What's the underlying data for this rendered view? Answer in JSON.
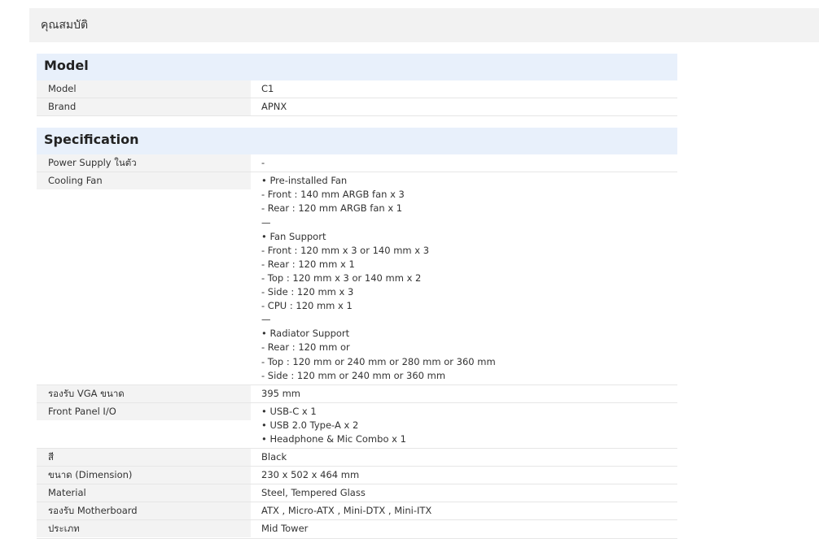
{
  "page": {
    "title": "คุณสมบัติ"
  },
  "sections": [
    {
      "header": "Model",
      "rows": [
        {
          "label": "Model",
          "value": [
            "C1"
          ]
        },
        {
          "label": "Brand",
          "value": [
            "APNX"
          ]
        }
      ]
    },
    {
      "header": "Specification",
      "rows": [
        {
          "label": "Power Supply ในตัว",
          "value": [
            "-"
          ]
        },
        {
          "label": "Cooling Fan",
          "value": [
            "• Pre-installed Fan",
            "- Front : 140 mm ARGB fan x 3",
            "- Rear : 120 mm ARGB fan x 1",
            "—",
            "• Fan Support",
            "- Front : 120 mm x 3 or 140 mm x 3",
            "- Rear : 120 mm x 1",
            "- Top : 120 mm x 3 or 140 mm x 2",
            "- Side : 120 mm x 3",
            "- CPU : 120 mm x 1",
            "—",
            "• Radiator Support",
            "- Rear : 120 mm or",
            "- Top : 120 mm or 240 mm or 280 mm or 360 mm",
            "- Side : 120 mm or 240 mm or 360 mm"
          ]
        },
        {
          "label": "รองรับ VGA ขนาด",
          "value": [
            "395 mm"
          ]
        },
        {
          "label": "Front Panel I/O",
          "value": [
            "• USB-C x 1",
            "• USB 2.0 Type-A x 2",
            "• Headphone & Mic Combo x 1"
          ]
        },
        {
          "label": "สี",
          "value": [
            "Black"
          ]
        },
        {
          "label": "ขนาด (Dimension)",
          "value": [
            "230 x 502 x 464 mm"
          ]
        },
        {
          "label": "Material",
          "value": [
            "Steel, Tempered Glass"
          ]
        },
        {
          "label": "รองรับ Motherboard",
          "value": [
            "ATX , Micro-ATX , Mini-DTX , Mini-ITX"
          ]
        },
        {
          "label": "ประเภท",
          "value": [
            "Mid Tower"
          ]
        }
      ]
    }
  ]
}
